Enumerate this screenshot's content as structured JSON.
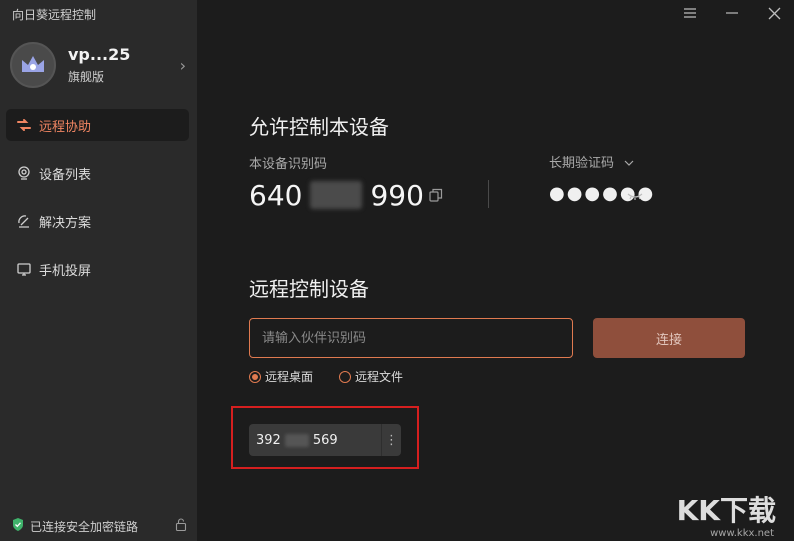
{
  "app": {
    "title": "向日葵远程控制"
  },
  "profile": {
    "name": "vp...25",
    "plan": "旗舰版"
  },
  "nav": {
    "items": [
      {
        "label": "远程协助",
        "icon": "remote-assist-icon",
        "active": true
      },
      {
        "label": "设备列表",
        "icon": "device-list-icon",
        "active": false
      },
      {
        "label": "解决方案",
        "icon": "solution-icon",
        "active": false
      },
      {
        "label": "手机投屏",
        "icon": "screen-cast-icon",
        "active": false
      }
    ]
  },
  "footer": {
    "status": "已连接安全加密链路"
  },
  "allow_control": {
    "title": "允许控制本设备",
    "id_label": "本设备识别码",
    "id_prefix": "640",
    "id_suffix": "990",
    "password_label": "长期验证码",
    "password_mask": "●●●●●●"
  },
  "remote_control": {
    "title": "远程控制设备",
    "input_placeholder": "请输入伙伴识别码",
    "connect_label": "连接",
    "modes": [
      {
        "label": "远程桌面",
        "selected": true
      },
      {
        "label": "远程文件",
        "selected": false
      }
    ],
    "recent": {
      "prefix": "392",
      "suffix": "569"
    }
  },
  "watermark": {
    "text": "KK下载",
    "url": "www.kkx.net"
  },
  "colors": {
    "accent": "#e07a50",
    "connect_bg": "#8f4f3c",
    "highlight": "#d51f1f"
  }
}
